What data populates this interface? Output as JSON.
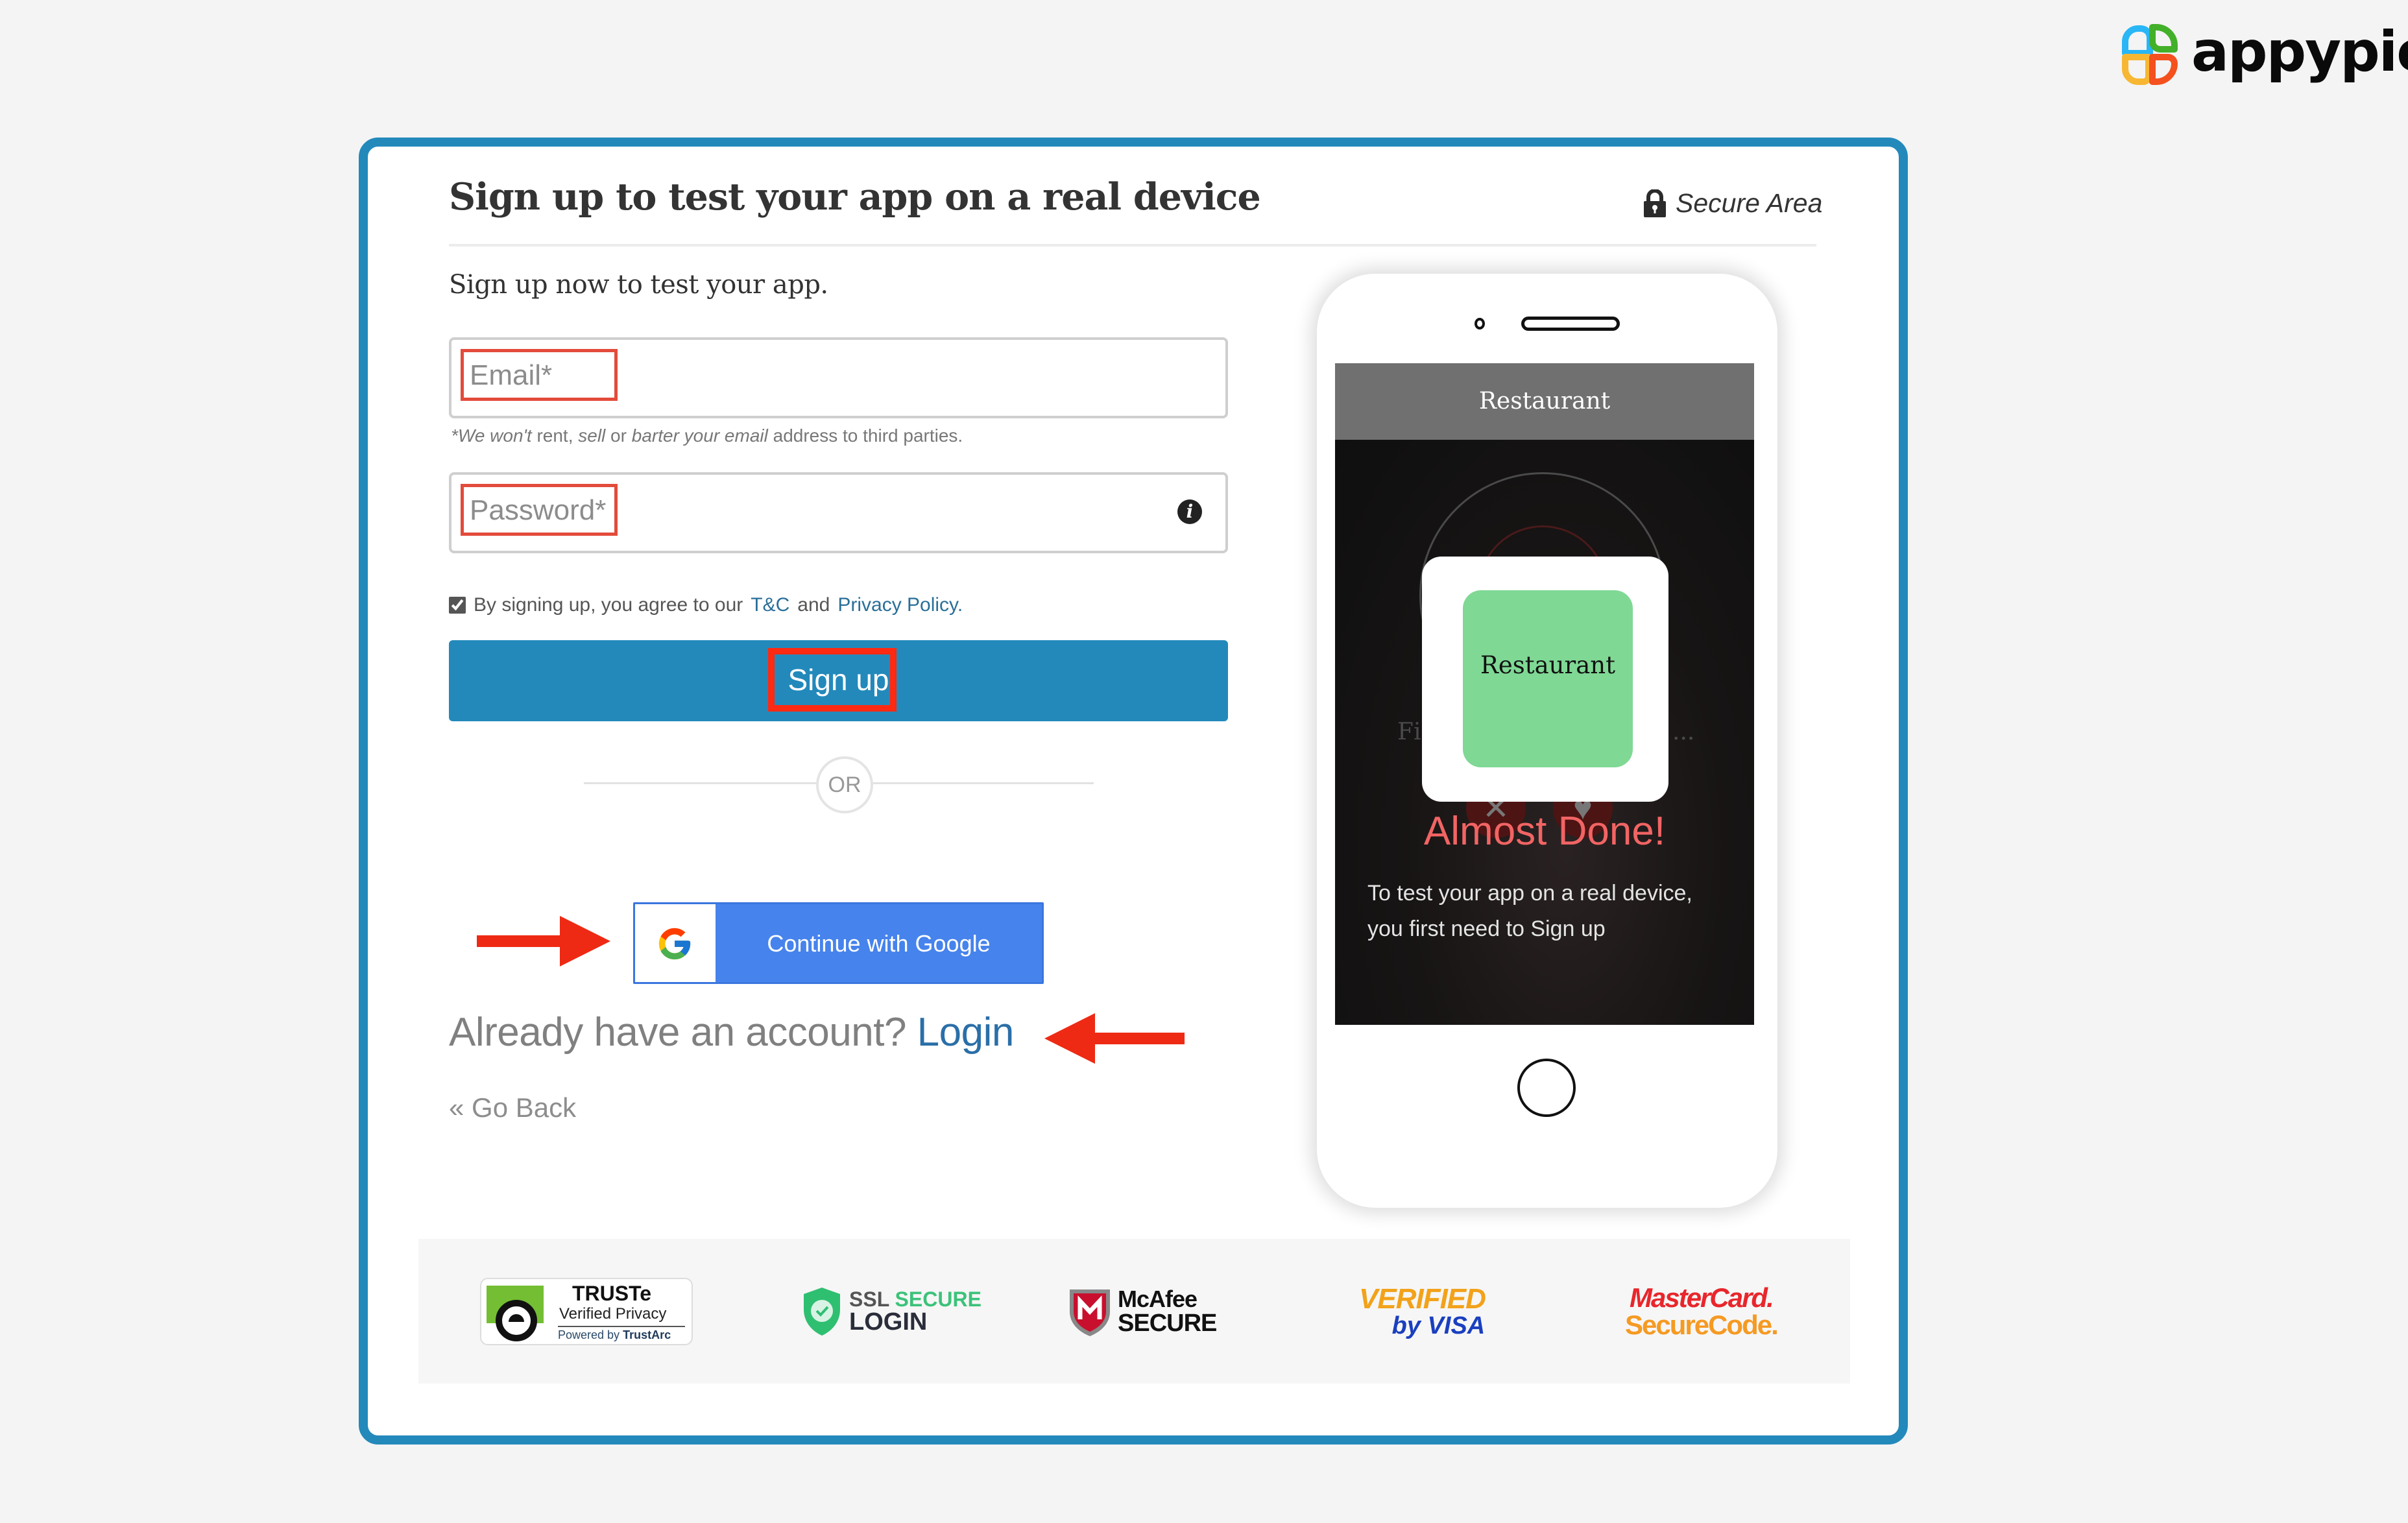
{
  "brand": {
    "name": "appypie",
    "logo_icon": "appypie-logo-icon"
  },
  "card": {
    "title": "Sign up to test your app on a real device",
    "secure_area": {
      "icon": "lock-icon",
      "label": "Secure Area"
    },
    "subtitle": "Sign up now to test your app.",
    "email": {
      "placeholder": "Email*",
      "value": "",
      "disclaimer": {
        "part1": "*We won't",
        "part2": " rent, ",
        "part3": "sell",
        "part4": " or ",
        "part5": "barter your email",
        "part6": " address to third parties."
      }
    },
    "password": {
      "placeholder": "Password*",
      "value": "",
      "info_icon": "info-icon",
      "info_glyph": "i"
    },
    "agreement": {
      "checked": true,
      "text_before": "By signing up, you agree to our",
      "tc_link": "T&C",
      "and": "and",
      "privacy_link": "Privacy Policy",
      "period": "."
    },
    "signup_button": "Sign up",
    "or_label": "OR",
    "google_button": {
      "icon": "google-g-icon",
      "label": "Continue with Google"
    },
    "already": {
      "text": "Already have an account?",
      "login_link": "Login"
    },
    "go_back": "« Go Back"
  },
  "phone": {
    "app_bar_title": "Restaurant",
    "background_text_left": "Fi",
    "background_text_right": "...",
    "dismiss_glyph": "✕",
    "like_glyph": "♥",
    "app_tile_label": "Restaurant",
    "heading": "Almost Done!",
    "message": "To test your app on a real device, you first need to Sign up"
  },
  "trust_badges": [
    {
      "name": "truste",
      "line1": "TRUSTe",
      "line2": "Verified Privacy",
      "line3_prefix": "Powered by ",
      "line3_brand": "TrustArc"
    },
    {
      "name": "ssl-secure-login",
      "line1_a": "SSL ",
      "line1_b": "SECURE",
      "line2": "LOGIN"
    },
    {
      "name": "mcafee-secure",
      "line1": "McAfee",
      "line2": "SECURE"
    },
    {
      "name": "verified-by-visa",
      "line1_tick": "V",
      "line1_rest": "ERIFIED",
      "line2": "by VISA"
    },
    {
      "name": "mastercard-securecode",
      "line1": "MasterCard.",
      "line2": "SecureCode."
    }
  ],
  "colors": {
    "accent_blue": "#2389bb",
    "google_blue": "#4683ec",
    "highlight_red": "#ff2a12",
    "link_blue": "#2a6fa8",
    "almost_done_red": "#f26464",
    "tile_green": "#7fd894"
  }
}
